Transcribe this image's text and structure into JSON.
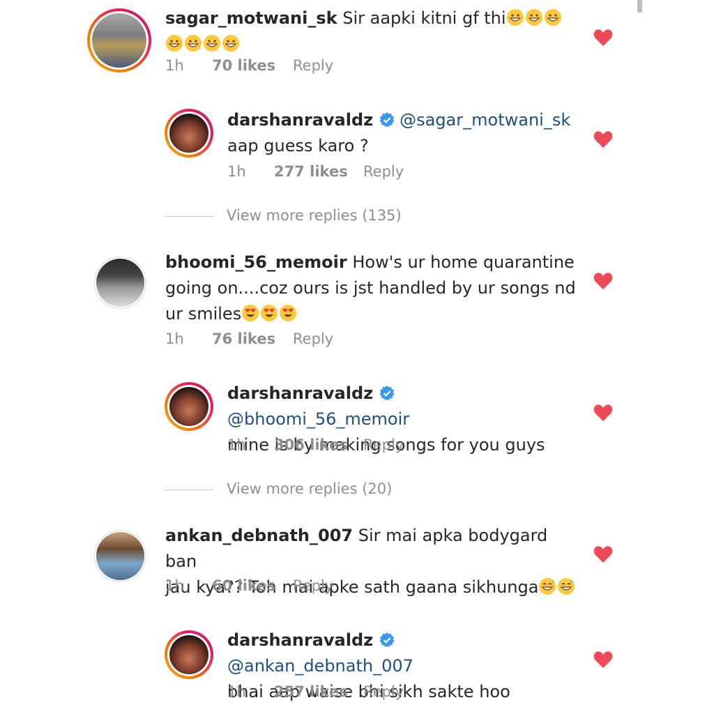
{
  "comments": [
    {
      "username": "sagar_motwani_sk",
      "text": "Sir  aapki kitni gf thi",
      "emojis": [
        "grinning-face",
        "grinning-face",
        "grinning-face",
        "grinning-face",
        "grinning-face",
        "grinning-face",
        "grinning-face"
      ],
      "time": "1h",
      "likes": "70 likes",
      "reply_label": "Reply",
      "liked": true
    },
    {
      "username": "darshanravaldz",
      "verified": true,
      "mention": "@sagar_motwani_sk",
      "text": "aap guess karo ?",
      "time": "1h",
      "likes": "277 likes",
      "reply_label": "Reply",
      "liked": true
    },
    {
      "username": "bhoomi_56_memoir",
      "text_line1": "How's ur home quarantine",
      "text_line2": "going on....coz ours is jst handled by ur songs nd",
      "text_line3": "ur smiles",
      "emojis": [
        "heart-eyes",
        "heart-eyes",
        "heart-eyes"
      ],
      "time": "1h",
      "likes": "76 likes",
      "reply_label": "Reply",
      "liked": true
    },
    {
      "username": "darshanravaldz",
      "verified": true,
      "mention": "@bhoomi_56_memoir",
      "text": "mine is by making songs for you guys",
      "time": "1h",
      "likes": "306 likes",
      "reply_label": "Reply",
      "liked": true
    },
    {
      "username": "ankan_debnath_007",
      "text_line1": "Sir mai apka bodygard ban",
      "text_line2": "jau kya?? Toh mai apke sath gaana sikhunga",
      "emojis": [
        "grinning-sweat",
        "grinning-sweat"
      ],
      "time": "1h",
      "likes": "60 likes",
      "reply_label": "Reply",
      "liked": true
    },
    {
      "username": "darshanravaldz",
      "verified": true,
      "mention": "@ankan_debnath_007",
      "text": "bhai aap waise bhi sikh sakte hoo",
      "time": "1h",
      "likes": "257 likes",
      "reply_label": "Reply",
      "liked": true
    }
  ],
  "view_more_replies": [
    "View more replies (135)",
    "View more replies (20)"
  ],
  "colors": {
    "heart": "#ed4956",
    "mention": "#1c4f86",
    "verified": "#3897f0",
    "muted": "#8e8e8e"
  }
}
